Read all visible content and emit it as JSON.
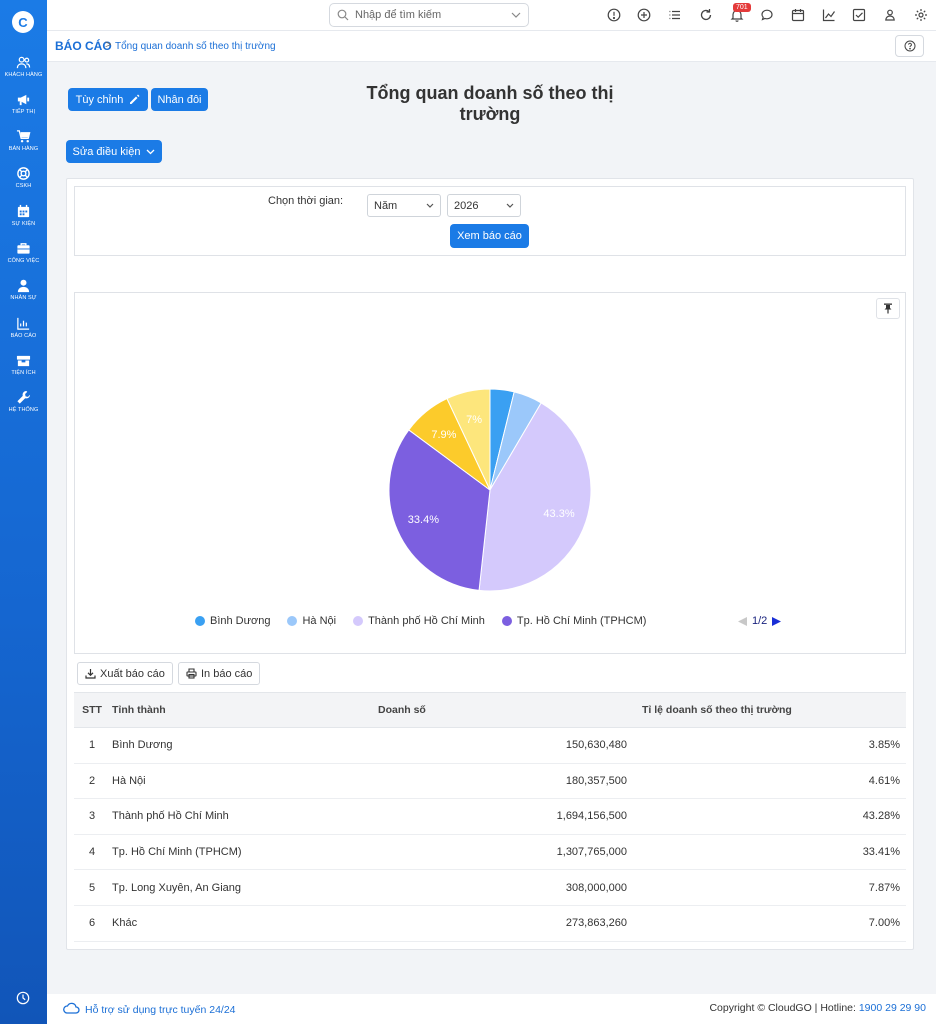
{
  "sidebar": {
    "logo": "C",
    "items": [
      {
        "label": "KHÁCH HÀNG",
        "icon": "users-icon"
      },
      {
        "label": "TIẾP THỊ",
        "icon": "megaphone-icon"
      },
      {
        "label": "BÁN HÀNG",
        "icon": "cart-icon"
      },
      {
        "label": "CSKH",
        "icon": "lifebuoy-icon"
      },
      {
        "label": "SỰ KIỆN",
        "icon": "calendar-icon"
      },
      {
        "label": "CÔNG VIỆC",
        "icon": "briefcase-icon"
      },
      {
        "label": "NHÂN SỰ",
        "icon": "person-icon"
      },
      {
        "label": "BÁO CÁO",
        "icon": "report-icon"
      },
      {
        "label": "TIỆN ÍCH",
        "icon": "box-icon"
      },
      {
        "label": "HỆ THỐNG",
        "icon": "wrench-icon"
      }
    ]
  },
  "topbar": {
    "search_placeholder": "Nhập để tìm kiếm",
    "notification_count": "701"
  },
  "breadcrumb": {
    "root": "BÁO CÁO",
    "separator": ">",
    "current": "Tổng quan doanh số theo thị trường"
  },
  "toolbar": {
    "customize_label": "Tùy chỉnh",
    "duplicate_label": "Nhân đôi",
    "edit_conditions_label": "Sửa điều kiện"
  },
  "page": {
    "title_line1": "Tổng quan doanh số theo thị",
    "title_line2": "trường"
  },
  "filter": {
    "label": "Chọn thời gian:",
    "period": "Năm",
    "year": "2026",
    "submit_label": "Xem báo cáo"
  },
  "chart_data": {
    "type": "pie",
    "categories": [
      "Bình Dương",
      "Hà Nội",
      "Thành phố Hồ Chí Minh",
      "Tp. Hồ Chí Minh (TPHCM)",
      "Tp. Long Xuyên, An Giang",
      "Khác"
    ],
    "values": [
      3.85,
      4.61,
      43.28,
      33.41,
      7.87,
      7.0
    ],
    "labels": [
      "",
      "",
      "43.3%",
      "33.4%",
      "7.9%",
      "7%"
    ],
    "colors": [
      "#3aa0f2",
      "#9bc8fa",
      "#d4c9fc",
      "#7c5fe0",
      "#fccb2b",
      "#fde67c"
    ],
    "legend_visible": [
      "Bình Dương",
      "Hà Nội",
      "Thành phố Hồ Chí Minh",
      "Tp. Hồ Chí Minh (TPHCM)"
    ],
    "legend_page": "1/2"
  },
  "actions": {
    "export_label": "Xuất báo cáo",
    "print_label": "In báo cáo"
  },
  "table": {
    "headers": [
      "STT",
      "Tỉnh thành",
      "Doanh số",
      "Tỉ lệ doanh số theo thị trường"
    ],
    "rows": [
      [
        "1",
        "Bình Dương",
        "150,630,480",
        "3.85%"
      ],
      [
        "2",
        "Hà Nội",
        "180,357,500",
        "4.61%"
      ],
      [
        "3",
        "Thành phố Hồ Chí Minh",
        "1,694,156,500",
        "43.28%"
      ],
      [
        "4",
        "Tp. Hồ Chí Minh (TPHCM)",
        "1,307,765,000",
        "33.41%"
      ],
      [
        "5",
        "Tp. Long Xuyên, An Giang",
        "308,000,000",
        "7.87%"
      ],
      [
        "6",
        "Khác",
        "273,863,260",
        "7.00%"
      ]
    ]
  },
  "footer": {
    "support": "Hỗ trợ sử dụng trực tuyến 24/24",
    "copyright": "Copyright © CloudGO",
    "hotline_label": "Hotline:",
    "hotline": "1900 29 29 90"
  }
}
